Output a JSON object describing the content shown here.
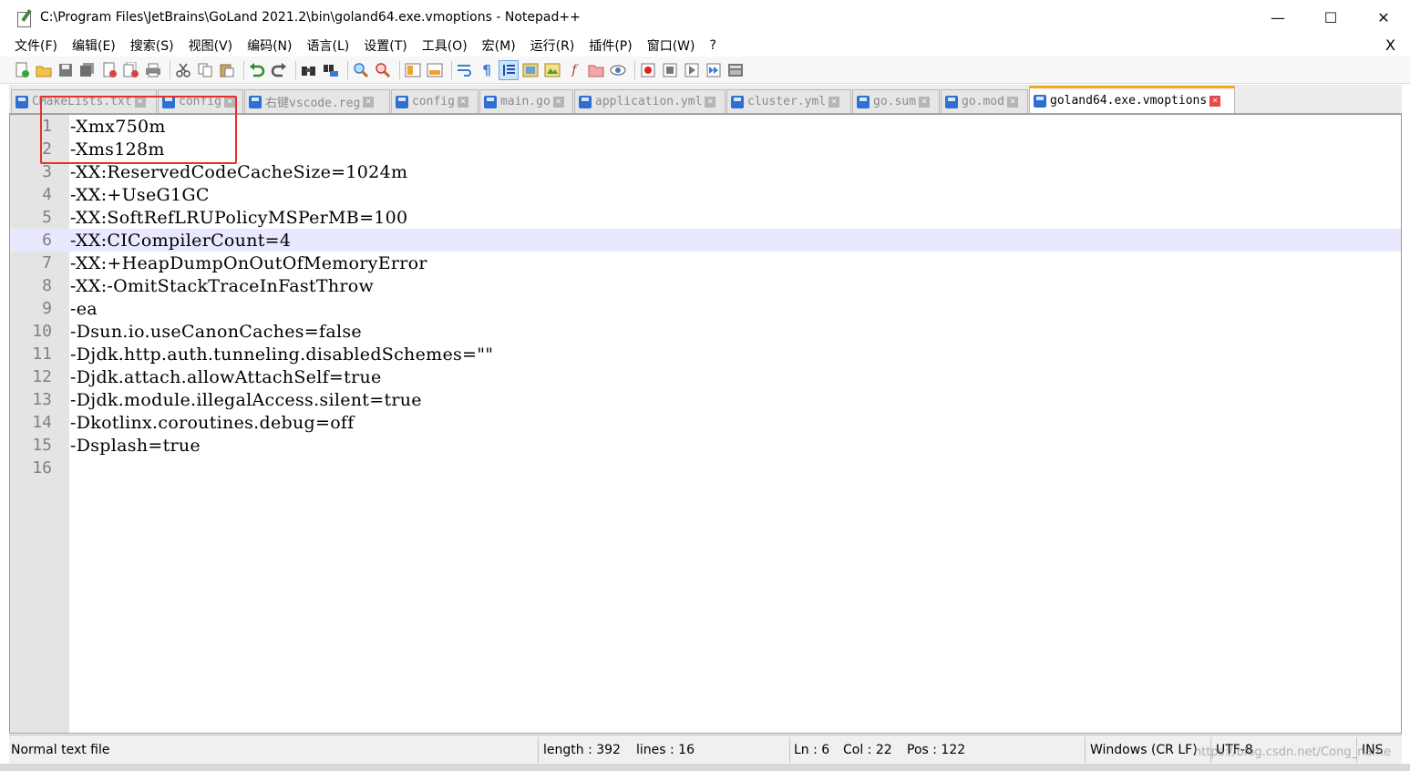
{
  "window": {
    "title": "C:\\Program Files\\JetBrains\\GoLand 2021.2\\bin\\goland64.exe.vmoptions - Notepad++",
    "minimize": "—",
    "maximize": "☐",
    "close": "✕"
  },
  "menu": {
    "items": [
      "文件(F)",
      "编辑(E)",
      "搜索(S)",
      "视图(V)",
      "编码(N)",
      "语言(L)",
      "设置(T)",
      "工具(O)",
      "宏(M)",
      "运行(R)",
      "插件(P)",
      "窗口(W)",
      "?"
    ],
    "close": "X"
  },
  "toolbar": {
    "icons": [
      "new-file-icon",
      "open-file-icon",
      "save-icon",
      "save-all-icon",
      "close-icon",
      "close-all-icon",
      "print-icon",
      "cut-icon",
      "copy-icon",
      "paste-icon",
      "undo-icon",
      "redo-icon",
      "find-icon",
      "replace-icon",
      "zoom-in-icon",
      "zoom-out-icon",
      "sync-vertical-icon",
      "sync-horizontal-icon",
      "word-wrap-icon",
      "show-all-chars-icon",
      "indent-guide-icon",
      "user-lang-icon",
      "doc-map-icon",
      "function-list-icon",
      "folder-workspace-icon",
      "monitor-icon",
      "record-macro-icon",
      "stop-record-icon",
      "play-macro-icon",
      "run-macro-multiple-icon",
      "save-macro-icon"
    ]
  },
  "tabs": [
    {
      "label": "CMakeLists.txt",
      "active": false
    },
    {
      "label": "config",
      "active": false
    },
    {
      "label": "右键vscode.reg",
      "active": false
    },
    {
      "label": "config",
      "active": false
    },
    {
      "label": "main.go",
      "active": false
    },
    {
      "label": "application.yml",
      "active": false
    },
    {
      "label": "cluster.yml",
      "active": false
    },
    {
      "label": "go.sum",
      "active": false
    },
    {
      "label": "go.mod",
      "active": false
    },
    {
      "label": "goland64.exe.vmoptions",
      "active": true
    }
  ],
  "editor": {
    "current_line": 6,
    "lines": [
      "-Xmx750m",
      "-Xms128m",
      "-XX:ReservedCodeCacheSize=1024m",
      "-XX:+UseG1GC",
      "-XX:SoftRefLRUPolicyMSPerMB=100",
      "-XX:CICompilerCount=4",
      "-XX:+HeapDumpOnOutOfMemoryError",
      "-XX:-OmitStackTraceInFastThrow",
      "-ea",
      "-Dsun.io.useCanonCaches=false",
      "-Djdk.http.auth.tunneling.disabledSchemes=\"\"",
      "-Djdk.attach.allowAttachSelf=true",
      "-Djdk.module.illegalAccess.silent=true",
      "-Dkotlinx.coroutines.debug=off",
      "-Dsplash=true",
      ""
    ]
  },
  "status": {
    "file_type": "Normal text file",
    "length": "length : 392",
    "lines": "lines : 16",
    "ln": "Ln : 6",
    "col": "Col : 22",
    "pos": "Pos : 122",
    "eol": "Windows (CR LF)",
    "encoding": "UTF-8",
    "mode": "INS"
  },
  "watermark": "https://blog.csdn.net/Cong_name"
}
